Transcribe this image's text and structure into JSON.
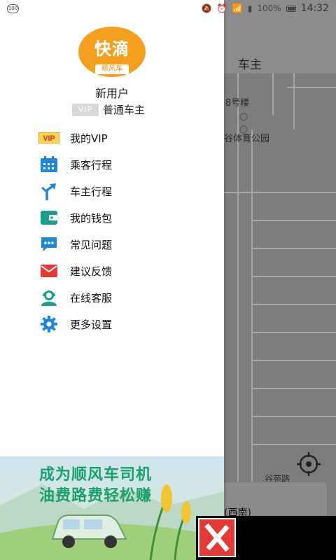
{
  "status_bar": {
    "left_badge": "100",
    "battery": "100%",
    "time": "14:32"
  },
  "map": {
    "title": "车主",
    "labels": [
      "8号楼",
      "谷体育公园",
      "谷苑路"
    ],
    "card_text": "(西南)"
  },
  "drawer": {
    "logo_main": "快滴",
    "logo_sub": "顺风车",
    "username": "新用户",
    "vip_tag": "VIP",
    "vip_level": "普通车主",
    "menu": [
      {
        "label": "我的VIP",
        "icon": "vip-icon"
      },
      {
        "label": "乘客行程",
        "icon": "calendar-icon"
      },
      {
        "label": "车主行程",
        "icon": "route-icon"
      },
      {
        "label": "我的钱包",
        "icon": "wallet-icon"
      },
      {
        "label": "常见问题",
        "icon": "chat-icon"
      },
      {
        "label": "建议反馈",
        "icon": "mail-icon"
      },
      {
        "label": "在线客服",
        "icon": "support-icon"
      },
      {
        "label": "更多设置",
        "icon": "gear-icon"
      }
    ]
  },
  "ad": {
    "line1": "成为顺风车司机",
    "line2": "油费路费轻松赚"
  },
  "colors": {
    "accent_blue": "#1e88d6",
    "ad_green": "#19a06b",
    "logo_orange": "#f4a01e",
    "close_red": "#e53935"
  }
}
